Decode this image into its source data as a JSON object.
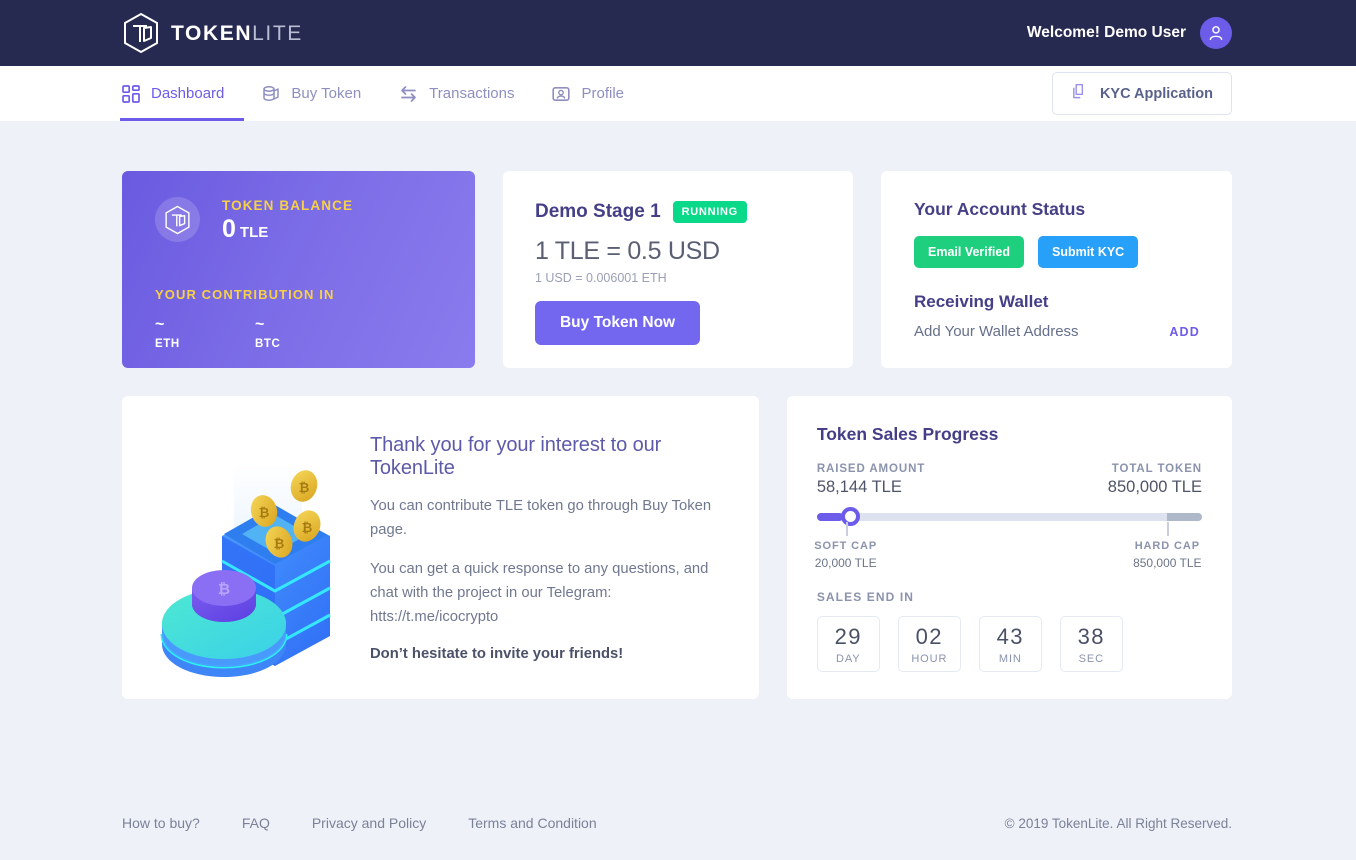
{
  "brand": {
    "name_bold": "TOKEN",
    "name_light": "LITE",
    "logo_icon": "hexagon-tl-logo-icon"
  },
  "topbar": {
    "welcome": "Welcome! Demo User",
    "avatar_icon": "user-avatar-icon",
    "bg_color": "#272a50"
  },
  "nav": {
    "items": [
      {
        "label": "Dashboard",
        "icon": "grid-dashboard-icon",
        "active": true
      },
      {
        "label": "Buy Token",
        "icon": "coins-stack-icon",
        "active": false
      },
      {
        "label": "Transactions",
        "icon": "swap-arrows-icon",
        "active": false
      },
      {
        "label": "Profile",
        "icon": "profile-card-icon",
        "active": false
      }
    ],
    "kyc_button": {
      "label": "KYC Application",
      "icon": "documents-copy-icon"
    },
    "accent_color": "#6c5ce9"
  },
  "balance_card": {
    "icon": "token-hexagon-icon",
    "label": "TOKEN BALANCE",
    "amount": "0",
    "unit": "TLE",
    "contribution_label": "YOUR CONTRIBUTION IN",
    "contributions": [
      {
        "value": "~",
        "currency": "ETH"
      },
      {
        "value": "~",
        "currency": "BTC"
      }
    ],
    "label_color": "#f7d046"
  },
  "stage_card": {
    "stage_name": "Demo Stage 1",
    "status_badge": "RUNNING",
    "status_color": "#0bd98a",
    "rate": "1 TLE = 0.5 USD",
    "sub_rate": "1 USD = 0.006001 ETH",
    "buy_button": "Buy Token Now",
    "buy_button_color": "#7367f0"
  },
  "account_card": {
    "title": "Your Account Status",
    "badges": [
      {
        "label": "Email Verified",
        "color": "#1ed07e"
      },
      {
        "label": "Submit KYC",
        "color": "#26a0f8"
      }
    ],
    "wallet_title": "Receiving Wallet",
    "wallet_placeholder": "Add Your Wallet Address",
    "wallet_add_label": "ADD"
  },
  "promo_card": {
    "illustration": "isometric-crypto-blocks-coins-illustration",
    "title": "Thank you for your interest to our TokenLite",
    "paragraph_1": "You can contribute TLE token go through Buy Token page.",
    "paragraph_2": "You can get a quick response to any questions, and chat with the project in our Telegram: htts://t.me/icocrypto",
    "closing": "Don’t hesitate to invite your friends!"
  },
  "progress_card": {
    "title": "Token Sales Progress",
    "raised_label": "RAISED AMOUNT",
    "raised_value": "58,144 TLE",
    "total_label": "TOTAL TOKEN",
    "total_value": "850,000 TLE",
    "soft_cap_label": "SOFT CAP",
    "soft_cap_value": "20,000 TLE",
    "hard_cap_label": "HARD CAP",
    "hard_cap_value": "850,000 TLE",
    "sales_end_label": "SALES END IN",
    "countdown": [
      {
        "value": "29",
        "unit": "DAY"
      },
      {
        "value": "02",
        "unit": "HOUR"
      },
      {
        "value": "43",
        "unit": "MIN"
      },
      {
        "value": "38",
        "unit": "SEC"
      }
    ],
    "progress_percent": 6.8,
    "soft_cap_percent": 7.5,
    "hard_cap_percent": 91,
    "fill_color": "#6c5ce9"
  },
  "footer": {
    "links": [
      "How to buy?",
      "FAQ",
      "Privacy and Policy",
      "Terms and Condition"
    ],
    "copyright": "© 2019 TokenLite. All Right Reserved."
  }
}
